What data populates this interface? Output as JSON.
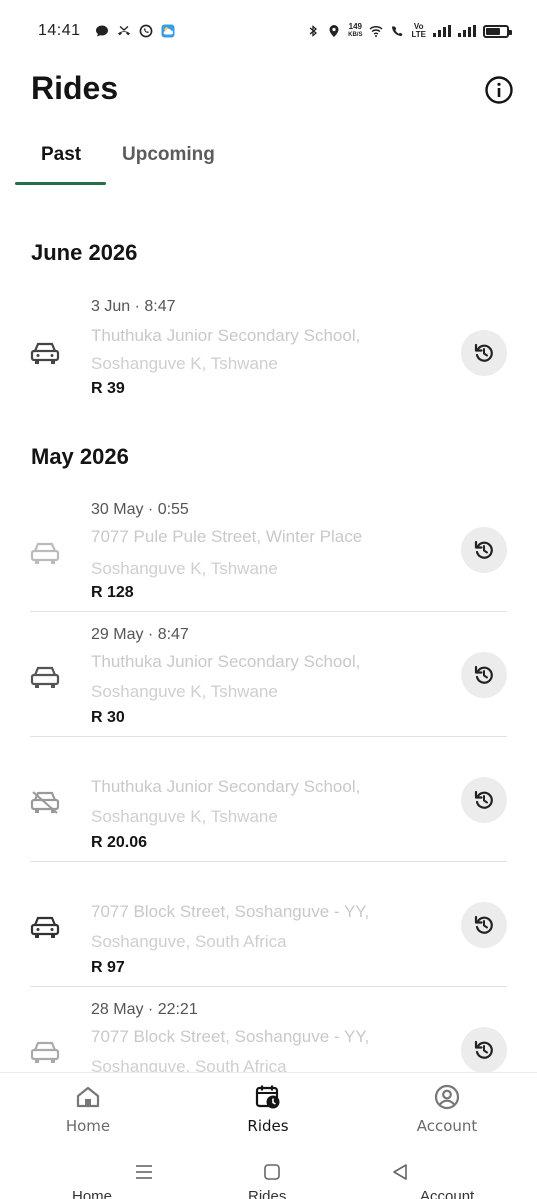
{
  "status_bar": {
    "time": "14:41",
    "net_speed_value": "149",
    "net_speed_unit": "KB/S",
    "volte_top": "Vo",
    "volte_bottom": "LTE"
  },
  "header": {
    "title": "Rides",
    "info_icon": "info-circle-icon"
  },
  "tabs": [
    {
      "label": "Past",
      "active": true
    },
    {
      "label": "Upcoming",
      "active": false
    }
  ],
  "accent_color": "#276e4a",
  "sections": [
    {
      "month": "June 2026",
      "rides": [
        {
          "date": "3 Jun · 8:47",
          "address_line1": "Thuthuka Junior Secondary School,",
          "address_line2": "Soshanguve K, Tshwane",
          "price": "R 39"
        }
      ]
    },
    {
      "month": "May 2026",
      "rides": [
        {
          "date": "30 May · 0:55",
          "address_line1": "7077 Pule Pule Street, Winter Place",
          "address_line2": "Soshanguve K, Tshwane",
          "price": "R 128"
        },
        {
          "date": "29 May · 8:47",
          "address_line1": "Thuthuka Junior Secondary School,",
          "address_line2": "Soshanguve K, Tshwane",
          "price": "R 30"
        },
        {
          "date": "",
          "address_line1": "Thuthuka Junior Secondary School,",
          "address_line2": "Soshanguve K, Tshwane",
          "price": "R 20.06"
        },
        {
          "date": "",
          "address_line1": "7077 Block Street, Soshanguve - YY,",
          "address_line2": "Soshanguve, South Africa",
          "price": "R 97"
        },
        {
          "date": "28 May · 22:21",
          "address_line1": "7077 Block Street, Soshanguve - YY,",
          "address_line2": "Soshanguve, South Africa",
          "price": ""
        }
      ]
    }
  ],
  "bottom_nav": [
    {
      "label": "Home",
      "icon": "home-icon",
      "active": false
    },
    {
      "label": "Rides",
      "icon": "calendar-clock-icon",
      "active": true
    },
    {
      "label": "Account",
      "icon": "account-circle-icon",
      "active": false
    }
  ],
  "ghost_labels": [
    "Home",
    "Rides",
    "Account"
  ]
}
